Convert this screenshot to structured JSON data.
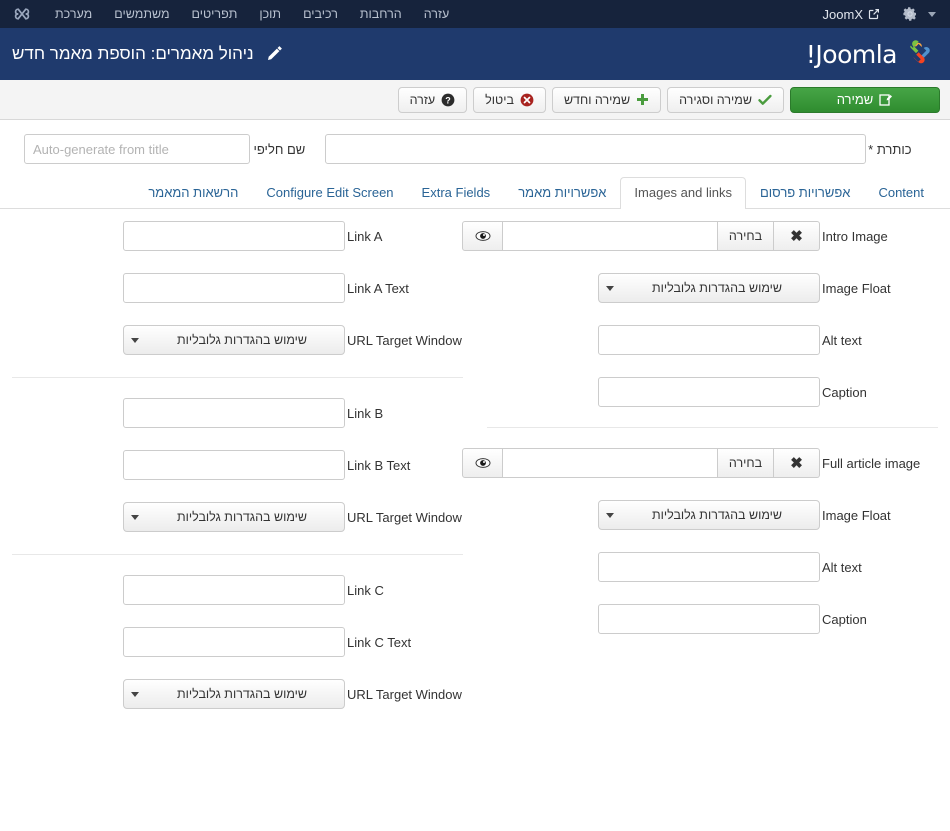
{
  "topbar": {
    "site_name": "JoomX",
    "menu": [
      "עזרה",
      "הרחבות",
      "רכיבים",
      "תוכן",
      "תפריטים",
      "משתמשים",
      "מערכת"
    ],
    "icons": {
      "caret": "chevron-down-icon",
      "gear": "gear-icon",
      "external": "external-link-icon",
      "brand": "joomla-x-icon"
    }
  },
  "header": {
    "logo_text": "Joomla!",
    "page_title": "ניהול מאמרים: הוספת מאמר חדש",
    "pencil_icon": "pencil-icon"
  },
  "toolbar": {
    "save_label": "שמירה",
    "save_close_label": "שמירה וסגירה",
    "save_new_label": "שמירה וחדש",
    "cancel_label": "ביטול",
    "help_label": "עזרה",
    "accent_green": "#2f8c2f",
    "cancel_red": "#a8231f"
  },
  "form": {
    "title_label": "כותרת *",
    "title_value": "",
    "title_placeholder": "",
    "alias_label": "שם חליפי",
    "alias_value": "",
    "alias_placeholder": "Auto-generate from title"
  },
  "tabs": [
    {
      "label": "Content",
      "active": false
    },
    {
      "label": "אפשרויות פרסום",
      "active": false
    },
    {
      "label": "Images and links",
      "active": true
    },
    {
      "label": "אפשרויות מאמר",
      "active": false
    },
    {
      "label": "Extra Fields",
      "active": false
    },
    {
      "label": "Configure Edit Screen",
      "active": false
    },
    {
      "label": "הרשאות המאמר",
      "active": false
    }
  ],
  "common": {
    "select_button": "בחירה",
    "clear_button": "✖",
    "use_global": "שימוש בהגדרות גלובליות",
    "eye_icon": "eye-icon"
  },
  "right_column": {
    "intro_image": {
      "label": "Intro Image",
      "value": "",
      "float_label": "Image Float",
      "float_value": "שימוש בהגדרות גלובליות",
      "alt_label": "Alt text",
      "alt_value": "",
      "caption_label": "Caption",
      "caption_value": ""
    },
    "full_article_image": {
      "label": "Full article image",
      "value": "",
      "float_label": "Image Float",
      "float_value": "שימוש בהגדרות גלובליות",
      "alt_label": "Alt text",
      "alt_value": "",
      "caption_label": "Caption",
      "caption_value": ""
    }
  },
  "left_column": {
    "link_a": {
      "label": "Link A",
      "value": "",
      "text_label": "Link A Text",
      "text_value": "",
      "target_label": "URL Target Window",
      "target_value": "שימוש בהגדרות גלובליות"
    },
    "link_b": {
      "label": "Link B",
      "value": "",
      "text_label": "Link B Text",
      "text_value": "",
      "target_label": "URL Target Window",
      "target_value": "שימוש בהגדרות גלובליות"
    },
    "link_c": {
      "label": "Link C",
      "value": "",
      "text_label": "Link C Text",
      "text_value": "",
      "target_label": "URL Target Window",
      "target_value": "שימוש בהגדרות גלובליות"
    }
  }
}
